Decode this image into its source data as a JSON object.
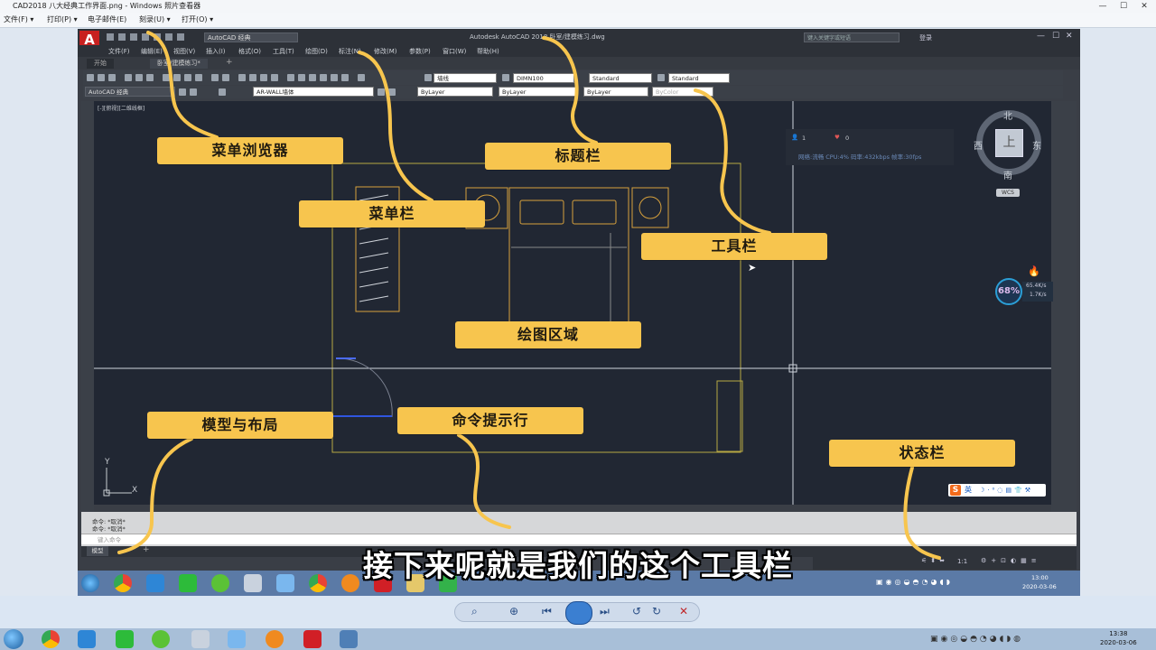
{
  "viewer": {
    "title": "CAD2018 八大经典工作界面.png - Windows 照片查看器",
    "menu": [
      "文件(F) ▾",
      "打印(P) ▾",
      "电子邮件(E)",
      "刻录(U) ▾",
      "打开(O) ▾"
    ],
    "window_controls": [
      "—",
      "☐",
      "✕"
    ]
  },
  "acad": {
    "logo": "A",
    "workspace": "AutoCAD 经典",
    "title": "Autodesk AutoCAD 2018    卧室/建模练习.dwg",
    "search_placeholder": "键入关键字或短语",
    "login": "登录",
    "menus": [
      "文件(F)",
      "编辑(E)",
      "视图(V)",
      "插入(I)",
      "格式(O)",
      "工具(T)",
      "绘图(D)",
      "标注(N)",
      "修改(M)",
      "参数(P)",
      "窗口(W)",
      "帮助(H)"
    ],
    "tabs": [
      "开始",
      "卧室/建模练习*"
    ],
    "toolbar_dropdowns": [
      "墙线",
      "DIMN100",
      "Standard",
      "Standard"
    ],
    "toolbar_row2": {
      "workspace": "AutoCAD 经典",
      "layer": "AR-WALL墙体",
      "color": "ByLayer",
      "linetype": "ByLayer",
      "lineweight": "ByLayer",
      "plotstyle": "ByColor"
    },
    "viewport_label": "[-][俯视][二维线框]",
    "compass": {
      "north": "北",
      "south": "南",
      "east": "东",
      "west": "西",
      "cube": "上",
      "wcs": "WCS"
    },
    "stats": {
      "users": "1",
      "likes": "0",
      "line2": "网络:流畅   CPU:4%   码率:432kbps   帧率:30fps"
    },
    "net_monitor": {
      "percent": "68%",
      "up": "65.4K/s",
      "down": "1.7K/s"
    },
    "command_history": [
      "命令: *取消*",
      "命令: *取消*"
    ],
    "command_placeholder": "键入命令",
    "layout_tab": "模型",
    "status_scale": "1:1",
    "ime": "英",
    "taskbar_clock": {
      "time": "13:00",
      "date": "2020-03-06"
    }
  },
  "callouts": {
    "menu_browser": "菜单浏览器",
    "title_bar": "标题栏",
    "menu_bar": "菜单栏",
    "toolbar": "工具栏",
    "drawing_area": "绘图区域",
    "model_layout": "模型与布局",
    "command_line": "命令提示行",
    "status_bar": "状态栏"
  },
  "subtitle": "接下来呢就是我们的这个工具栏",
  "outer_clock": {
    "time": "13:38",
    "date": "2020-03-06"
  },
  "colors": {
    "callout": "#f7c54e",
    "drawing_bg": "#212733",
    "outline": "#d6a03c",
    "brand_red": "#c8201f"
  }
}
